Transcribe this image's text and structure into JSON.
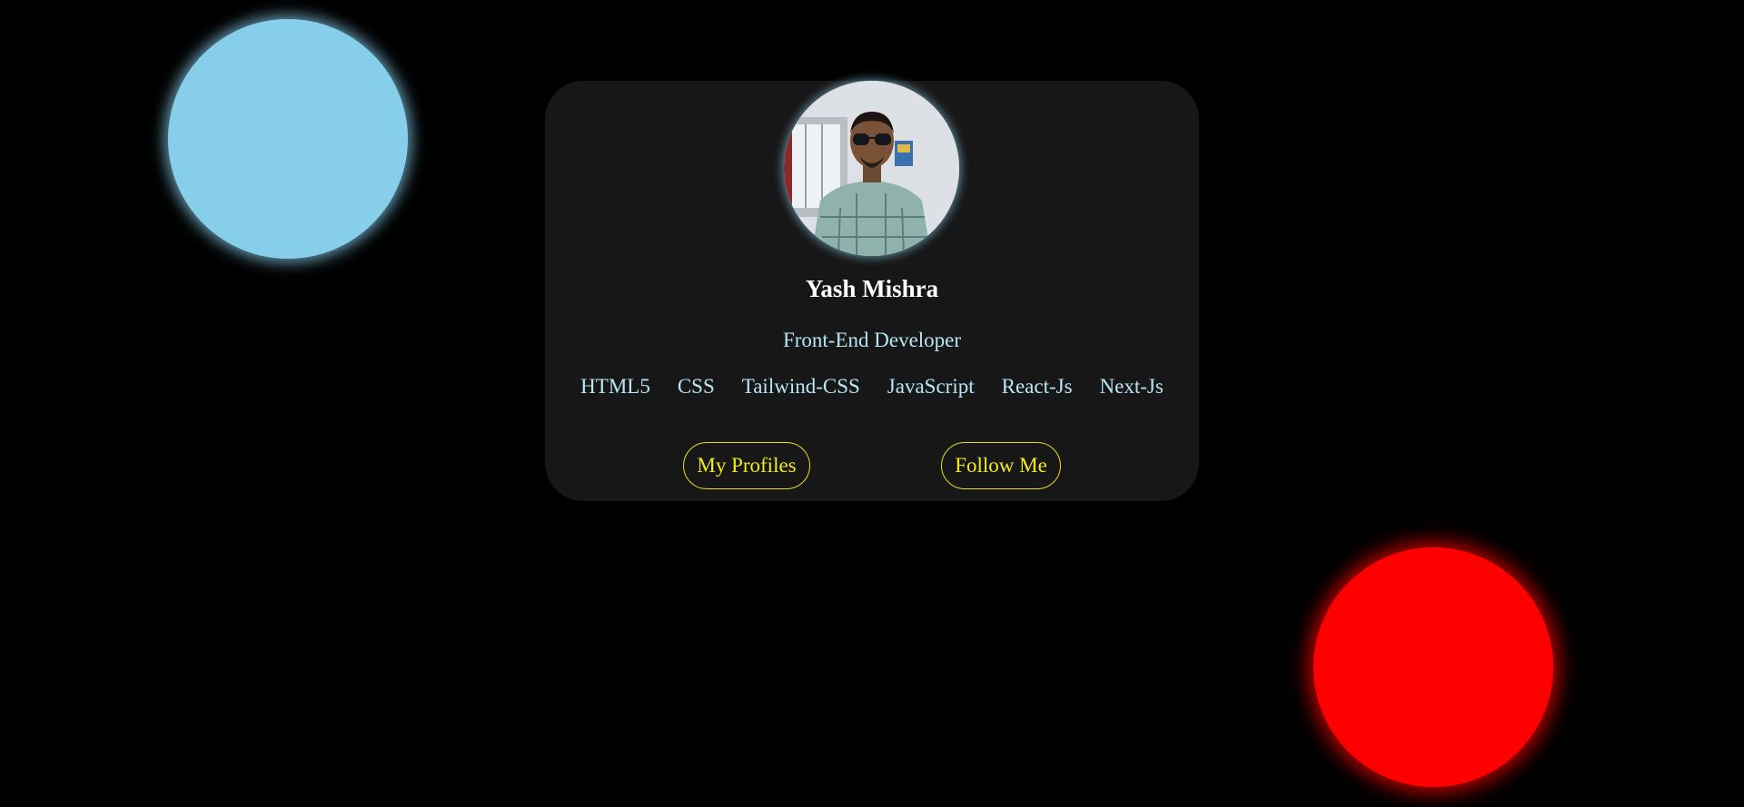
{
  "profile": {
    "name": "Yash Mishra",
    "role": "Front-End Developer",
    "skills": [
      "HTML5",
      "CSS",
      "Tailwind-CSS",
      "JavaScript",
      "React-Js",
      "Next-Js"
    ]
  },
  "buttons": {
    "profiles_label": "My Profiles",
    "follow_label": "Follow Me"
  },
  "colors": {
    "background": "#000000",
    "card": "#181718",
    "orb_blue": "#87ceeb",
    "orb_red": "#ff0000",
    "accent_text": "#b9e6f5",
    "button_accent": "#f1ea1c"
  },
  "avatar": {
    "icon": "profile-photo"
  }
}
